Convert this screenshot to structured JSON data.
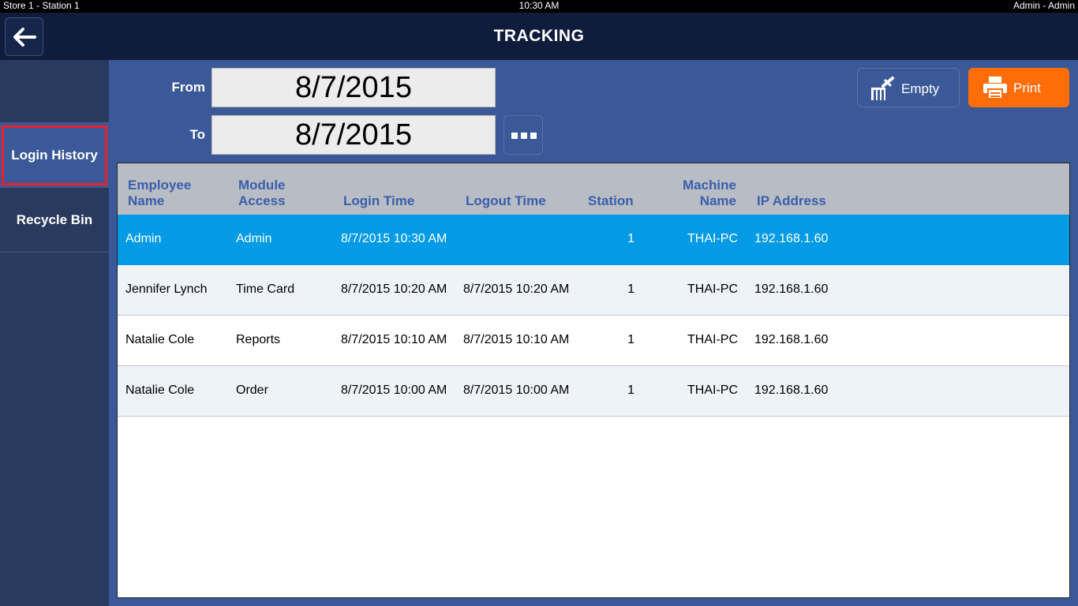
{
  "status_bar": {
    "left": "Store 1 - Station 1",
    "center": "10:30 AM",
    "right": "Admin - Admin"
  },
  "header": {
    "title": "TRACKING",
    "back_icon": "arrow-left-icon"
  },
  "sidebar": {
    "items": [
      {
        "label": "Login History",
        "selected": true
      },
      {
        "label": "Recycle Bin",
        "selected": false
      }
    ]
  },
  "filters": {
    "from_label": "From",
    "from_value": "8/7/2015",
    "to_label": "To",
    "to_value": "8/7/2015",
    "more_icon": "more-dots-icon"
  },
  "actions": {
    "empty_label": "Empty",
    "empty_icon": "trash-clear-icon",
    "print_label": "Print",
    "print_icon": "printer-icon"
  },
  "table": {
    "columns": [
      {
        "line1": "Employee",
        "line2": "Name"
      },
      {
        "line1": "Module",
        "line2": "Access"
      },
      {
        "line1": "",
        "line2": "Login Time"
      },
      {
        "line1": "",
        "line2": "Logout Time"
      },
      {
        "line1": "",
        "line2": "Station"
      },
      {
        "line1": "Machine",
        "line2": "Name"
      },
      {
        "line1": "",
        "line2": "IP Address"
      }
    ],
    "rows": [
      {
        "employee": "Admin",
        "module": "Admin",
        "login": "8/7/2015 10:30 AM",
        "logout": "",
        "station": "1",
        "machine": "THAI-PC",
        "ip": "192.168.1.60"
      },
      {
        "employee": "Jennifer Lynch",
        "module": "Time Card",
        "login": "8/7/2015 10:20 AM",
        "logout": "8/7/2015 10:20 AM",
        "station": "1",
        "machine": "THAI-PC",
        "ip": "192.168.1.60"
      },
      {
        "employee": "Natalie Cole",
        "module": "Reports",
        "login": "8/7/2015 10:10 AM",
        "logout": "8/7/2015 10:10 AM",
        "station": "1",
        "machine": "THAI-PC",
        "ip": "192.168.1.60"
      },
      {
        "employee": "Natalie Cole",
        "module": "Order",
        "login": "8/7/2015 10:00 AM",
        "logout": "8/7/2015 10:00 AM",
        "station": "1",
        "machine": "THAI-PC",
        "ip": "192.168.1.60"
      }
    ]
  },
  "colors": {
    "accent": "#039be5",
    "print": "#ff6d0a",
    "header_text": "#3b5eab",
    "highlight": "#e8202a"
  }
}
